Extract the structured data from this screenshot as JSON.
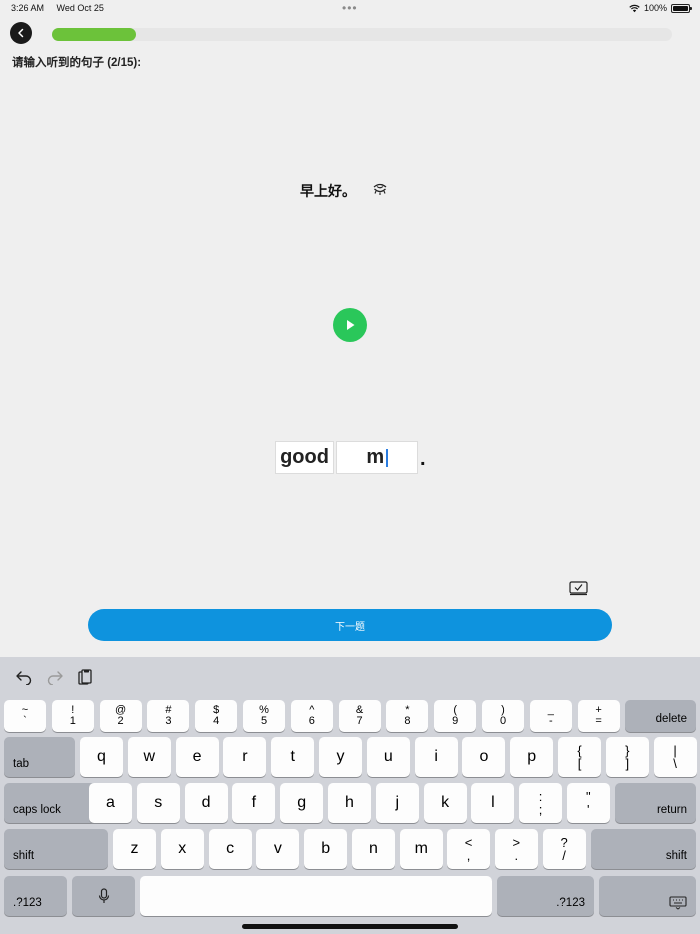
{
  "status_bar": {
    "time": "3:26 AM",
    "date": "Wed Oct 25",
    "battery": "100%"
  },
  "progress": {
    "fraction": 0.135
  },
  "prompt": "请输入听到的句子 (2/15):",
  "sentence": "早上好。",
  "answer": {
    "word1": "good",
    "word2": "m",
    "punct": "."
  },
  "next_button": "下一题",
  "colors": {
    "progress": "#6cc23a",
    "play": "#2ac75a",
    "next_button": "#0e93de"
  },
  "keyboard": {
    "row1": [
      {
        "top": "~",
        "bottom": "`"
      },
      {
        "top": "!",
        "bottom": "1"
      },
      {
        "top": "@",
        "bottom": "2"
      },
      {
        "top": "#",
        "bottom": "3"
      },
      {
        "top": "$",
        "bottom": "4"
      },
      {
        "top": "%",
        "bottom": "5"
      },
      {
        "top": "^",
        "bottom": "6"
      },
      {
        "top": "&",
        "bottom": "7"
      },
      {
        "top": "*",
        "bottom": "8"
      },
      {
        "top": "(",
        "bottom": "9"
      },
      {
        "top": ")",
        "bottom": "0"
      },
      {
        "top": "_",
        "bottom": "-"
      },
      {
        "top": "+",
        "bottom": "="
      }
    ],
    "delete": "delete",
    "tab": "tab",
    "row2": [
      "q",
      "w",
      "e",
      "r",
      "t",
      "y",
      "u",
      "i",
      "o",
      "p"
    ],
    "row2_sym": [
      {
        "top": "{",
        "bottom": "["
      },
      {
        "top": "}",
        "bottom": "]"
      },
      {
        "top": "|",
        "bottom": "\\"
      }
    ],
    "caps_lock": "caps lock",
    "row3": [
      "a",
      "s",
      "d",
      "f",
      "g",
      "h",
      "j",
      "k",
      "l"
    ],
    "row3_sym": [
      {
        "top": ":",
        "bottom": ";"
      },
      {
        "top": "\"",
        "bottom": "'"
      }
    ],
    "return": "return",
    "shift": "shift",
    "row4": [
      "z",
      "x",
      "c",
      "v",
      "b",
      "n",
      "m"
    ],
    "row4_sym": [
      {
        "top": "<",
        "bottom": ","
      },
      {
        "top": ">",
        "bottom": "."
      },
      {
        "top": "?",
        "bottom": "/"
      }
    ],
    "numbers_label": ".?123"
  }
}
